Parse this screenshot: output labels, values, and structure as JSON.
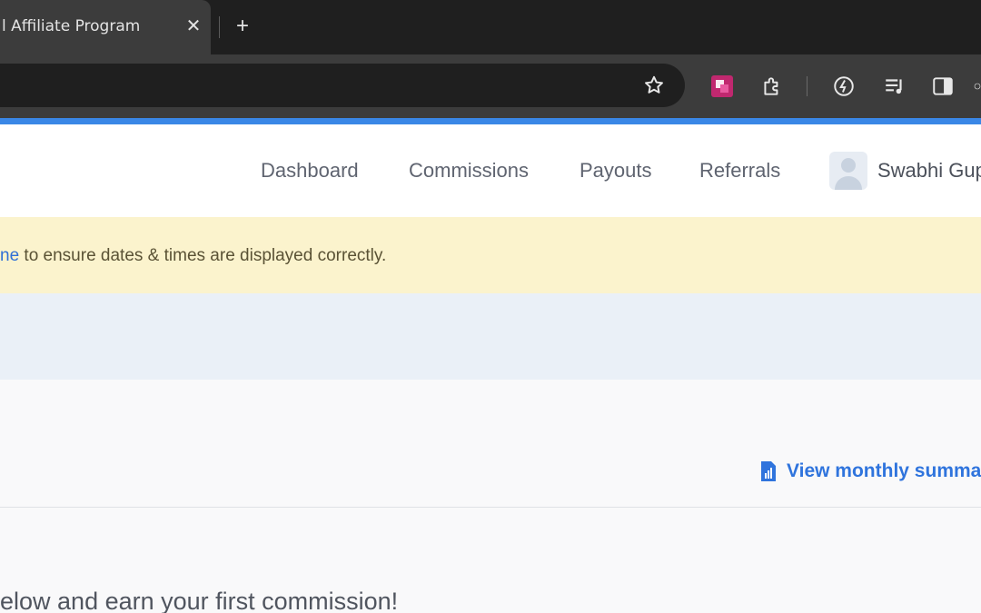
{
  "browser": {
    "tab_title": "l Affiliate Program",
    "tab_close": "✕",
    "new_tab": "+"
  },
  "nav": {
    "items": [
      "Dashboard",
      "Commissions",
      "Payouts",
      "Referrals"
    ],
    "user_name": "Swabhi Gup"
  },
  "notice": {
    "link_text": "ne",
    "text": " to ensure dates & times are displayed correctly."
  },
  "summary": {
    "label": "View monthly summary"
  },
  "cta": {
    "text": "elow and earn your first commission!"
  },
  "colors": {
    "accent": "#3a87e6",
    "link": "#2f74dd",
    "warning_bg": "#fbf3cd",
    "info_bg": "#eaf0f7"
  }
}
